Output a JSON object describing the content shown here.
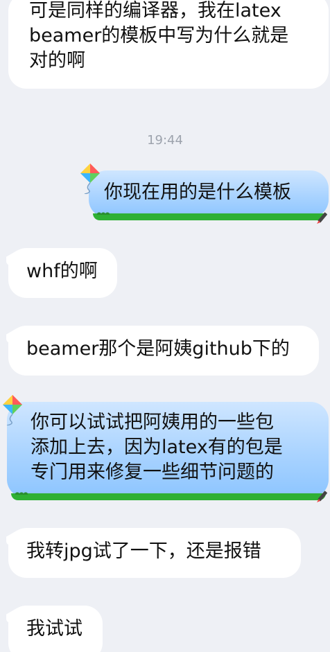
{
  "messages": [
    {
      "id": "m1",
      "side": "incoming",
      "lines": [
        "可是同样的编译器，我在latex",
        "beamer的模板中写为什么就是",
        "对的啊"
      ]
    },
    {
      "id": "m2",
      "side": "outgoing",
      "lines": [
        "你现在用的是什么模板"
      ]
    },
    {
      "id": "m3",
      "side": "incoming",
      "lines": [
        "whf的啊"
      ]
    },
    {
      "id": "m4",
      "side": "incoming",
      "lines": [
        "beamer那个是阿姨github下的"
      ]
    },
    {
      "id": "m5",
      "side": "outgoing",
      "lines": [
        "你可以试试把阿姨用的一些包",
        "添加上去，因为latex有的包是",
        "专门用来修复一些细节问题的"
      ]
    },
    {
      "id": "m6",
      "side": "incoming",
      "lines": [
        "我转jpg试了一下，还是报错"
      ]
    },
    {
      "id": "m7",
      "side": "incoming",
      "lines": [
        "我试试"
      ]
    }
  ],
  "timestamp": "19:44",
  "icons": {
    "kite": "kite-icon",
    "pen": "pen-icon"
  },
  "colors": {
    "background": "#eef0f5",
    "incoming_bubble": "#ffffff",
    "outgoing_bubble": "#a9d3ff",
    "grass": "#2fb034",
    "timestamp": "#9da3ad"
  }
}
